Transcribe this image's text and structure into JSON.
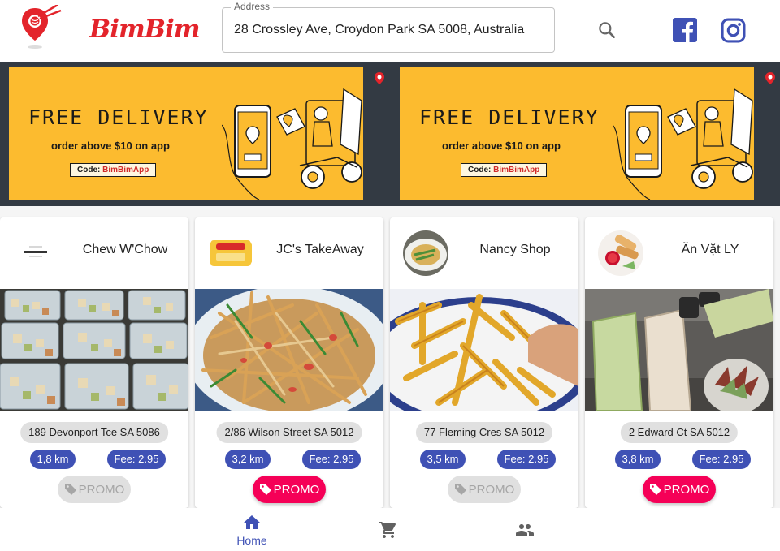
{
  "header": {
    "brand": "BimBim",
    "address_label": "Address",
    "address_value": "28 Crossley Ave, Croydon Park SA 5008, Australia",
    "icons": [
      "pin-noodles-logo-icon",
      "search-icon",
      "facebook-icon",
      "instagram-icon"
    ]
  },
  "banners": [
    {
      "title": "FREE DELIVERY",
      "subtitle": "order above $10 on app",
      "code_label": "Code:",
      "code_value": "BimBimApp"
    },
    {
      "title": "FREE DELIVERY",
      "subtitle": "order above $10 on app",
      "code_label": "Code:",
      "code_value": "BimBimApp"
    }
  ],
  "shops": [
    {
      "name": "Chew W'Chow",
      "address": "189 Devonport Tce SA 5086",
      "distance": "1,8 km",
      "fee": "Fee: 2.95",
      "promo": "PROMO",
      "promo_active": false
    },
    {
      "name": "JC's TakeAway",
      "address": "2/86 Wilson Street SA 5012",
      "distance": "3,2 km",
      "fee": "Fee: 2.95",
      "promo": "PROMO",
      "promo_active": true
    },
    {
      "name": "Nancy Shop",
      "address": "77 Fleming Cres SA 5012",
      "distance": "3,5 km",
      "fee": "Fee: 2.95",
      "promo": "PROMO",
      "promo_active": false
    },
    {
      "name": "Ăn Vặt LY",
      "address": "2 Edward Ct SA 5012",
      "distance": "3,8 km",
      "fee": "Fee: 2.95",
      "promo": "PROMO",
      "promo_active": true
    }
  ],
  "nav": {
    "home_label": "Home",
    "items": [
      "home-icon",
      "cart-icon",
      "people-icon"
    ],
    "active": "home"
  },
  "colors": {
    "brand_red": "#e3242b",
    "primary": "#3f51b5",
    "promo_pink": "#f50057",
    "banner_yellow": "#fcbb2f",
    "banner_frame": "#333a43"
  }
}
